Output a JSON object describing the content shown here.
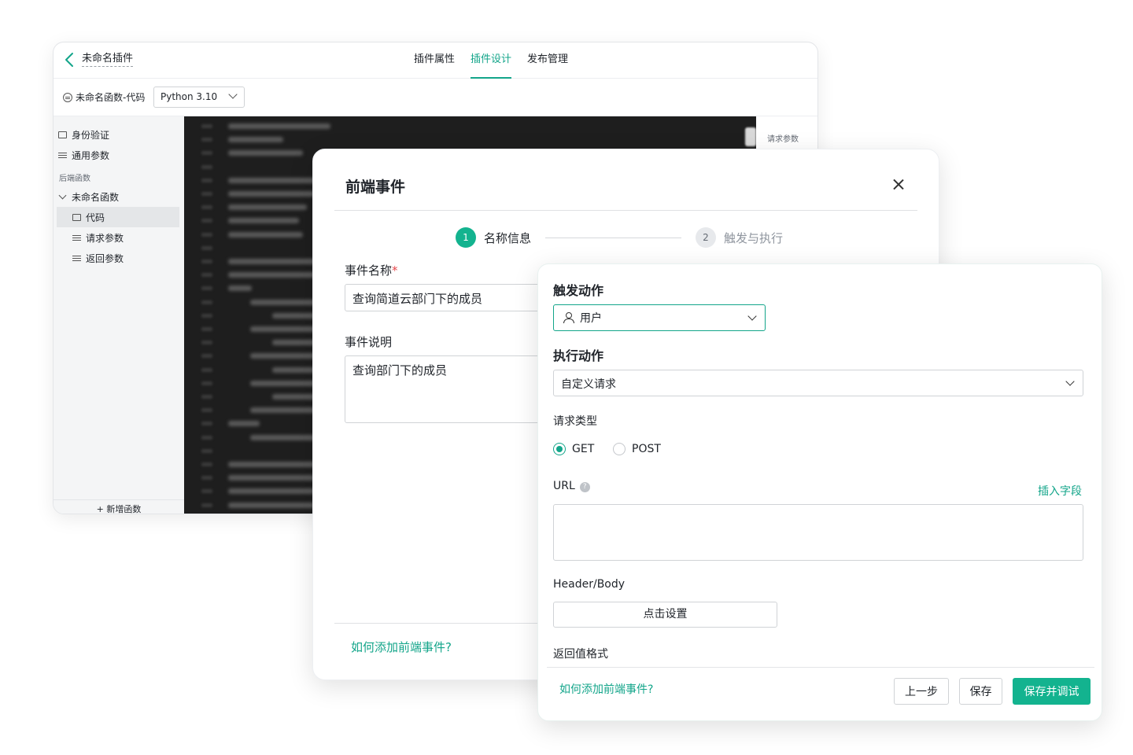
{
  "editor": {
    "plugin_name": "未命名插件",
    "tabs": [
      {
        "label": "插件属性"
      },
      {
        "label": "插件设计"
      },
      {
        "label": "发布管理"
      }
    ],
    "function_label": "未命名函数-代码",
    "language": "Python 3.10",
    "sidebar": {
      "auth": "身份验证",
      "common_params": "通用参数",
      "backend_group": "后端函数",
      "function_name": "未命名函数",
      "code": "代码",
      "request_params": "请求参数",
      "return_params": "返回参数",
      "add_function": "新增函数"
    },
    "right_panel_label": "请求参数"
  },
  "dialog": {
    "title": "前端事件",
    "steps": [
      {
        "num": "1",
        "label": "名称信息"
      },
      {
        "num": "2",
        "label": "触发与执行"
      }
    ],
    "event_name_label": "事件名称",
    "required_mark": "*",
    "event_name_value": "查询简道云部门下的成员",
    "event_desc_label": "事件说明",
    "event_desc_value": "查询部门下的成员",
    "help_link": "如何添加前端事件?"
  },
  "panel": {
    "trigger_heading": "触发动作",
    "trigger_value": "用户",
    "action_heading": "执行动作",
    "action_value": "自定义请求",
    "request_type_label": "请求类型",
    "request_types": [
      "GET",
      "POST"
    ],
    "selected_request_type": "GET",
    "url_label": "URL",
    "help_glyph": "?",
    "insert_field": "插入字段",
    "header_body_label": "Header/Body",
    "set_button": "点击设置",
    "return_format_label": "返回值格式",
    "help_link": "如何添加前端事件?",
    "prev_button": "上一步",
    "save_button": "保存",
    "save_debug_button": "保存并调试"
  },
  "colors": {
    "accent": "#13a58a",
    "primary_button": "#13b38f",
    "required": "#e5484d",
    "code_bg": "#1e1e1e"
  }
}
